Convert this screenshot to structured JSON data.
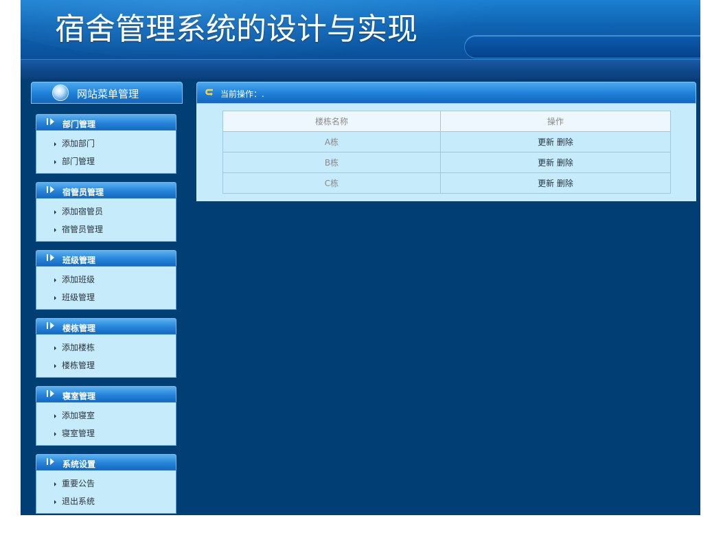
{
  "app": {
    "title": "宿舍管理系统的设计与实现"
  },
  "sidebar": {
    "title": "网站菜单管理",
    "groups": [
      {
        "title": "部门管理",
        "items": [
          "添加部门",
          "部门管理"
        ]
      },
      {
        "title": "宿管员管理",
        "items": [
          "添加宿管员",
          "宿管员管理"
        ]
      },
      {
        "title": "班级管理",
        "items": [
          "添加班级",
          "班级管理"
        ]
      },
      {
        "title": "楼栋管理",
        "items": [
          "添加楼栋",
          "楼栋管理"
        ]
      },
      {
        "title": "寝室管理",
        "items": [
          "添加寝室",
          "寝室管理"
        ]
      },
      {
        "title": "系统设置",
        "items": [
          "重要公告",
          "退出系统"
        ]
      }
    ]
  },
  "main": {
    "header_label": "当前操作：.",
    "table": {
      "columns": [
        "楼栋名称",
        "操作"
      ],
      "rows": [
        {
          "name": "A栋",
          "update": "更新",
          "delete": "删除"
        },
        {
          "name": "B栋",
          "update": "更新",
          "delete": "删除"
        },
        {
          "name": "C栋",
          "update": "更新",
          "delete": "删除"
        }
      ]
    }
  },
  "colors": {
    "background": "#003e74",
    "panel": "#c6ebfb",
    "header_blue": "#1e7fd6"
  },
  "icons": {
    "sidebar_header": "globe-icon",
    "menu_group": "play-arrow-icon",
    "menu_item": "triangle-bullet-icon",
    "main_header": "return-arrow-icon"
  }
}
